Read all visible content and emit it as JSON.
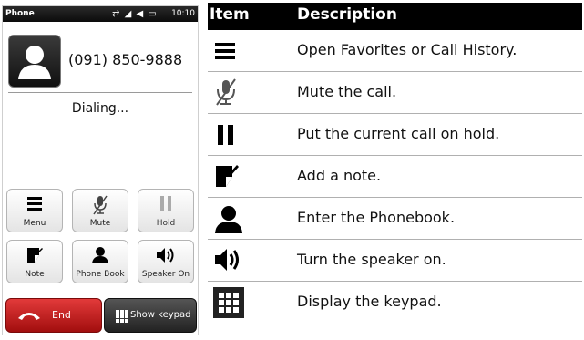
{
  "phone": {
    "status_bar": {
      "app_name": "Phone",
      "time": "10:10"
    },
    "caller_number": "(091) 850-9888",
    "call_status": "Dialing...",
    "buttons": [
      {
        "label": "Menu",
        "icon": "menu-icon"
      },
      {
        "label": "Mute",
        "icon": "mute-icon"
      },
      {
        "label": "Hold",
        "icon": "hold-icon"
      },
      {
        "label": "Note",
        "icon": "note-icon"
      },
      {
        "label": "Phone Book",
        "icon": "phonebook-icon"
      },
      {
        "label": "Speaker On",
        "icon": "speaker-icon"
      }
    ],
    "end_label": "End",
    "keypad_label": "Show keypad"
  },
  "legend": {
    "header_item": "Item",
    "header_description": "Description",
    "rows": [
      {
        "icon": "menu-icon",
        "description": "Open Favorites or Call History."
      },
      {
        "icon": "mute-icon",
        "description": "Mute the call."
      },
      {
        "icon": "hold-icon",
        "description": "Put the current call on hold."
      },
      {
        "icon": "note-icon",
        "description": "Add a note."
      },
      {
        "icon": "phonebook-icon",
        "description": "Enter the Phonebook."
      },
      {
        "icon": "speaker-icon",
        "description": "Turn the speaker on."
      },
      {
        "icon": "keypad-icon",
        "description": "Display the keypad."
      }
    ]
  },
  "colors": {
    "end_button": "#c21a1a",
    "header_bg": "#000000"
  }
}
